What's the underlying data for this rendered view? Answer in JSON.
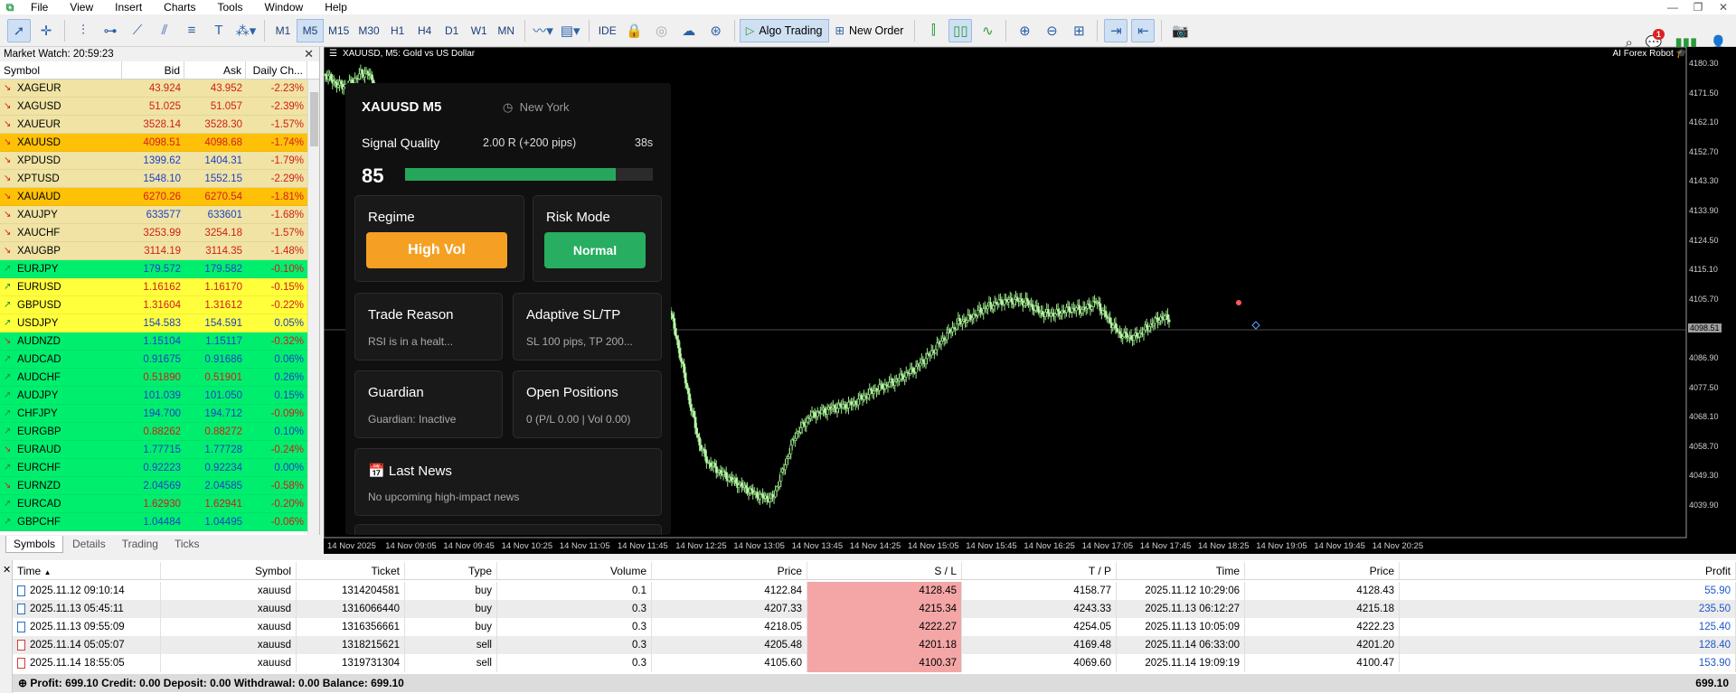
{
  "menu": {
    "items": [
      "File",
      "View",
      "Insert",
      "Charts",
      "Tools",
      "Window",
      "Help"
    ]
  },
  "toolbar": {
    "timeframes": [
      "M1",
      "M5",
      "M15",
      "M30",
      "H1",
      "H4",
      "D1",
      "W1",
      "MN"
    ],
    "active_timeframe": "M5",
    "ide_label": "IDE",
    "algo_label": "Algo Trading",
    "new_order_label": "New Order",
    "notification_count": "1"
  },
  "market_watch": {
    "title": "Market Watch: 20:59:23",
    "columns": [
      "Symbol",
      "Bid",
      "Ask",
      "Daily Ch..."
    ],
    "rows": [
      {
        "symbol": "XAGEUR",
        "bid": "43.924",
        "ask": "43.952",
        "change": "-2.23%",
        "bg": "#f0e3a4",
        "dir": "down",
        "color": "#d21c1c"
      },
      {
        "symbol": "XAGUSD",
        "bid": "51.025",
        "ask": "51.057",
        "change": "-2.39%",
        "bg": "#f0e3a4",
        "dir": "down",
        "color": "#d21c1c"
      },
      {
        "symbol": "XAUEUR",
        "bid": "3528.14",
        "ask": "3528.30",
        "change": "-1.57%",
        "bg": "#f0e3a4",
        "dir": "down",
        "color": "#d21c1c"
      },
      {
        "symbol": "XAUUSD",
        "bid": "4098.51",
        "ask": "4098.68",
        "change": "-1.74%",
        "bg": "#ffc107",
        "dir": "down",
        "color": "#d21c1c"
      },
      {
        "symbol": "XPDUSD",
        "bid": "1399.62",
        "ask": "1404.31",
        "change": "-1.79%",
        "bg": "#f0e3a4",
        "dir": "down",
        "color": "#1c3fc8"
      },
      {
        "symbol": "XPTUSD",
        "bid": "1548.10",
        "ask": "1552.15",
        "change": "-2.29%",
        "bg": "#f0e3a4",
        "dir": "down",
        "color": "#1c3fc8"
      },
      {
        "symbol": "XAUAUD",
        "bid": "6270.26",
        "ask": "6270.54",
        "change": "-1.81%",
        "bg": "#ffc107",
        "dir": "down",
        "color": "#d21c1c"
      },
      {
        "symbol": "XAUJPY",
        "bid": "633577",
        "ask": "633601",
        "change": "-1.68%",
        "bg": "#f0e3a4",
        "dir": "down",
        "color": "#1c3fc8"
      },
      {
        "symbol": "XAUCHF",
        "bid": "3253.99",
        "ask": "3254.18",
        "change": "-1.57%",
        "bg": "#f0e3a4",
        "dir": "down",
        "color": "#d21c1c"
      },
      {
        "symbol": "XAUGBP",
        "bid": "3114.19",
        "ask": "3114.35",
        "change": "-1.48%",
        "bg": "#f0e3a4",
        "dir": "down",
        "color": "#d21c1c"
      },
      {
        "symbol": "EURJPY",
        "bid": "179.572",
        "ask": "179.582",
        "change": "-0.10%",
        "bg": "#00ee6e",
        "dir": "up",
        "color": "#1c3fc8"
      },
      {
        "symbol": "EURUSD",
        "bid": "1.16162",
        "ask": "1.16170",
        "change": "-0.15%",
        "bg": "#ffff3c",
        "dir": "up",
        "color": "#d21c1c"
      },
      {
        "symbol": "GBPUSD",
        "bid": "1.31604",
        "ask": "1.31612",
        "change": "-0.22%",
        "bg": "#ffff3c",
        "dir": "up",
        "color": "#d21c1c"
      },
      {
        "symbol": "USDJPY",
        "bid": "154.583",
        "ask": "154.591",
        "change": "0.05%",
        "bg": "#ffff3c",
        "dir": "up",
        "color": "#1c3fc8"
      },
      {
        "symbol": "AUDNZD",
        "bid": "1.15104",
        "ask": "1.15117",
        "change": "-0.32%",
        "bg": "#00ee6e",
        "dir": "down",
        "color": "#1c3fc8"
      },
      {
        "symbol": "AUDCAD",
        "bid": "0.91675",
        "ask": "0.91686",
        "change": "0.06%",
        "bg": "#00ee6e",
        "dir": "up",
        "color": "#1c3fc8"
      },
      {
        "symbol": "AUDCHF",
        "bid": "0.51890",
        "ask": "0.51901",
        "change": "0.26%",
        "bg": "#00ee6e",
        "dir": "up",
        "color": "#d21c1c"
      },
      {
        "symbol": "AUDJPY",
        "bid": "101.039",
        "ask": "101.050",
        "change": "0.15%",
        "bg": "#00ee6e",
        "dir": "up",
        "color": "#1c3fc8"
      },
      {
        "symbol": "CHFJPY",
        "bid": "194.700",
        "ask": "194.712",
        "change": "-0.09%",
        "bg": "#00ee6e",
        "dir": "up",
        "color": "#1c3fc8"
      },
      {
        "symbol": "EURGBP",
        "bid": "0.88262",
        "ask": "0.88272",
        "change": "0.10%",
        "bg": "#00ee6e",
        "dir": "up",
        "color": "#d21c1c"
      },
      {
        "symbol": "EURAUD",
        "bid": "1.77715",
        "ask": "1.77728",
        "change": "-0.24%",
        "bg": "#00ee6e",
        "dir": "down",
        "color": "#1c3fc8"
      },
      {
        "symbol": "EURCHF",
        "bid": "0.92223",
        "ask": "0.92234",
        "change": "0.00%",
        "bg": "#00ee6e",
        "dir": "up",
        "color": "#1c3fc8"
      },
      {
        "symbol": "EURNZD",
        "bid": "2.04569",
        "ask": "2.04585",
        "change": "-0.58%",
        "bg": "#00ee6e",
        "dir": "down",
        "color": "#1c3fc8"
      },
      {
        "symbol": "EURCAD",
        "bid": "1.62930",
        "ask": "1.62941",
        "change": "-0.20%",
        "bg": "#00ee6e",
        "dir": "up",
        "color": "#d21c1c"
      },
      {
        "symbol": "GBPCHF",
        "bid": "1.04484",
        "ask": "1.04495",
        "change": "-0.06%",
        "bg": "#00ee6e",
        "dir": "up",
        "color": "#1c3fc8"
      }
    ],
    "tabs": [
      "Symbols",
      "Details",
      "Trading",
      "Ticks"
    ]
  },
  "chart": {
    "title": "XAUUSD, M5:  Gold vs US Dollar",
    "robot_label": "AI Forex Robot",
    "current_price_label": "4098.51",
    "y_labels": [
      "4180.30",
      "4171.50",
      "4162.10",
      "4152.70",
      "4143.30",
      "4133.90",
      "4124.50",
      "4115.10",
      "4105.70",
      "4096.30",
      "4086.90",
      "4077.50",
      "4068.10",
      "4058.70",
      "4049.30",
      "4039.90"
    ],
    "x_labels": [
      "14 Nov 2025",
      "14 Nov 09:05",
      "14 Nov 09:45",
      "14 Nov 10:25",
      "14 Nov 11:05",
      "14 Nov 11:45",
      "14 Nov 12:25",
      "14 Nov 13:05",
      "14 Nov 13:45",
      "14 Nov 14:25",
      "14 Nov 15:05",
      "14 Nov 15:45",
      "14 Nov 16:25",
      "14 Nov 17:05",
      "14 Nov 17:45",
      "14 Nov 18:25",
      "14 Nov 19:05",
      "14 Nov 19:45",
      "14 Nov 20:25"
    ]
  },
  "panel": {
    "symbol": "XAUUSD M5",
    "city": "New York",
    "quality_label": "Signal Quality",
    "rr": "2.00 R (+200 pips)",
    "timer": "38s",
    "score": "85",
    "score_pct": 85,
    "regime": {
      "title": "Regime",
      "value": "High Vol",
      "color": "#f5a023"
    },
    "risk": {
      "title": "Risk Mode",
      "value": "Normal",
      "color": "#27ae60"
    },
    "trade_reason": {
      "title": "Trade Reason",
      "value": "RSI is in a healt..."
    },
    "adaptive": {
      "title": "Adaptive SL/TP",
      "value": "SL 100 pips, TP 200..."
    },
    "guardian": {
      "title": "Guardian",
      "value": "Guardian: Inactive"
    },
    "positions": {
      "title": "Open Positions",
      "value": "0 (P/L 0.00 | Vol 0.00)"
    },
    "news": {
      "title": "Last News",
      "value": "No upcoming high-impact news"
    }
  },
  "trades": {
    "columns": [
      "Time",
      "Symbol",
      "Ticket",
      "Type",
      "Volume",
      "Price",
      "S / L",
      "T / P",
      "Time",
      "Price",
      "Profit"
    ],
    "rows": [
      {
        "time": "2025.11.12 09:10:14",
        "symbol": "xauusd",
        "ticket": "1314204581",
        "type": "buy",
        "volume": "0.1",
        "price": "4122.84",
        "sl": "4128.45",
        "tp": "4158.77",
        "ctime": "2025.11.12 10:29:06",
        "cprice": "4128.43",
        "profit": "55.90"
      },
      {
        "time": "2025.11.13 05:45:11",
        "symbol": "xauusd",
        "ticket": "1316066440",
        "type": "buy",
        "volume": "0.3",
        "price": "4207.33",
        "sl": "4215.34",
        "tp": "4243.33",
        "ctime": "2025.11.13 06:12:27",
        "cprice": "4215.18",
        "profit": "235.50"
      },
      {
        "time": "2025.11.13 09:55:09",
        "symbol": "xauusd",
        "ticket": "1316356661",
        "type": "buy",
        "volume": "0.3",
        "price": "4218.05",
        "sl": "4222.27",
        "tp": "4254.05",
        "ctime": "2025.11.13 10:05:09",
        "cprice": "4222.23",
        "profit": "125.40"
      },
      {
        "time": "2025.11.14 05:05:07",
        "symbol": "xauusd",
        "ticket": "1318215621",
        "type": "sell",
        "volume": "0.3",
        "price": "4205.48",
        "sl": "4201.18",
        "tp": "4169.48",
        "ctime": "2025.11.14 06:33:00",
        "cprice": "4201.20",
        "profit": "128.40"
      },
      {
        "time": "2025.11.14 18:55:05",
        "symbol": "xauusd",
        "ticket": "1319731304",
        "type": "sell",
        "volume": "0.3",
        "price": "4105.60",
        "sl": "4100.37",
        "tp": "4069.60",
        "ctime": "2025.11.14 19:09:19",
        "cprice": "4100.47",
        "profit": "153.90"
      }
    ],
    "footer": "Profit: 699.10  Credit: 0.00  Deposit: 0.00  Withdrawal: 0.00  Balance: 699.10",
    "total": "699.10"
  }
}
